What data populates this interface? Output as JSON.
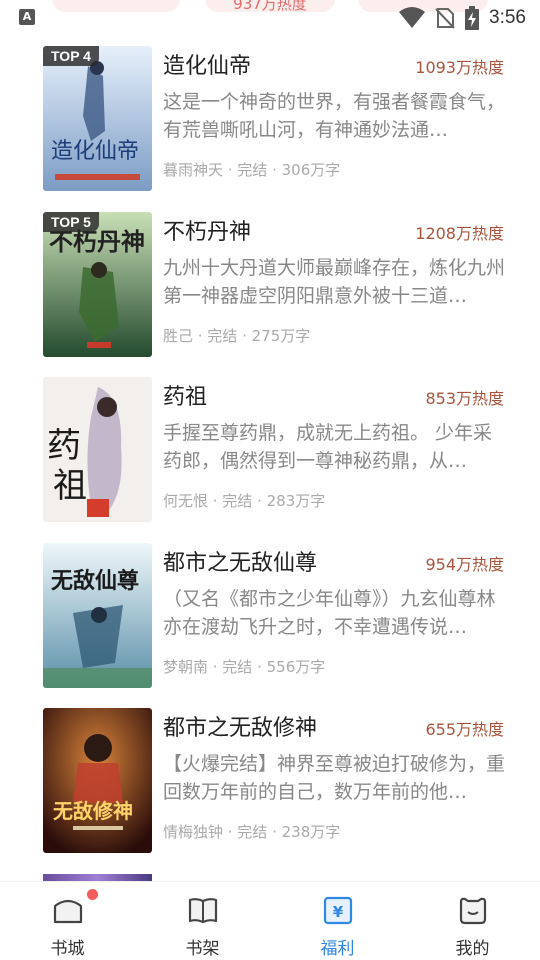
{
  "status_bar": {
    "left_icon": "A",
    "time": "3:56",
    "peek_text": "937万热度",
    "icons": [
      "wifi-icon",
      "no-sim-icon",
      "battery-charging-icon"
    ]
  },
  "books": [
    {
      "rank_badge": "TOP 4",
      "title": "造化仙帝",
      "heat": "1093万热度",
      "description": "这是一个神奇的世界，有强者餐霞食气，有荒兽嘶吼山河，有神通妙法通…",
      "meta": "暮雨神天 · 完结 · 306万字",
      "cover_colors": [
        "#cfe1f5",
        "#5c7ea8"
      ]
    },
    {
      "rank_badge": "TOP 5",
      "title": "不朽丹神",
      "heat": "1208万热度",
      "description": "九州十大丹道大师最巅峰存在，炼化九州第一神器虚空阴阳鼎意外被十三道…",
      "meta": "胜己 · 完结 · 275万字",
      "cover_colors": [
        "#a9c98e",
        "#2e5c3a"
      ]
    },
    {
      "rank_badge": "",
      "title": "药祖",
      "heat": "853万热度",
      "description": "手握至尊药鼎，成就无上药祖。 少年采药郎，偶然得到一尊神秘药鼎，从…",
      "meta": "何无恨 · 完结 · 283万字",
      "cover_colors": [
        "#f0ece8",
        "#6b5f72"
      ]
    },
    {
      "rank_badge": "",
      "title": "都市之无敌仙尊",
      "heat": "954万热度",
      "description": "（又名《都市之少年仙尊》）九玄仙尊林亦在渡劫飞升之时，不幸遭遇传说…",
      "meta": "梦朝南 · 完结 · 556万字",
      "cover_colors": [
        "#d8ecf2",
        "#3c6d8c"
      ]
    },
    {
      "rank_badge": "",
      "title": "都市之无敌修神",
      "heat": "655万热度",
      "description": "【火爆完结】神界至尊被迫打破修为，重回数万年前的自己，数万年前的他…",
      "meta": "情梅独钟 · 完结 · 238万字",
      "cover_colors": [
        "#3a1410",
        "#b85a22"
      ]
    }
  ],
  "tabs": [
    {
      "label": "书城",
      "icon": "bookstore-icon",
      "active": false,
      "badge": true
    },
    {
      "label": "书架",
      "icon": "bookshelf-icon",
      "active": false,
      "badge": false
    },
    {
      "label": "福利",
      "icon": "welfare-icon",
      "active": true,
      "badge": false
    },
    {
      "label": "我的",
      "icon": "profile-icon",
      "active": false,
      "badge": false
    }
  ],
  "colors": {
    "accent": "#2e86e6",
    "heat": "#a9553e",
    "badge_dot": "#f35a5a"
  }
}
